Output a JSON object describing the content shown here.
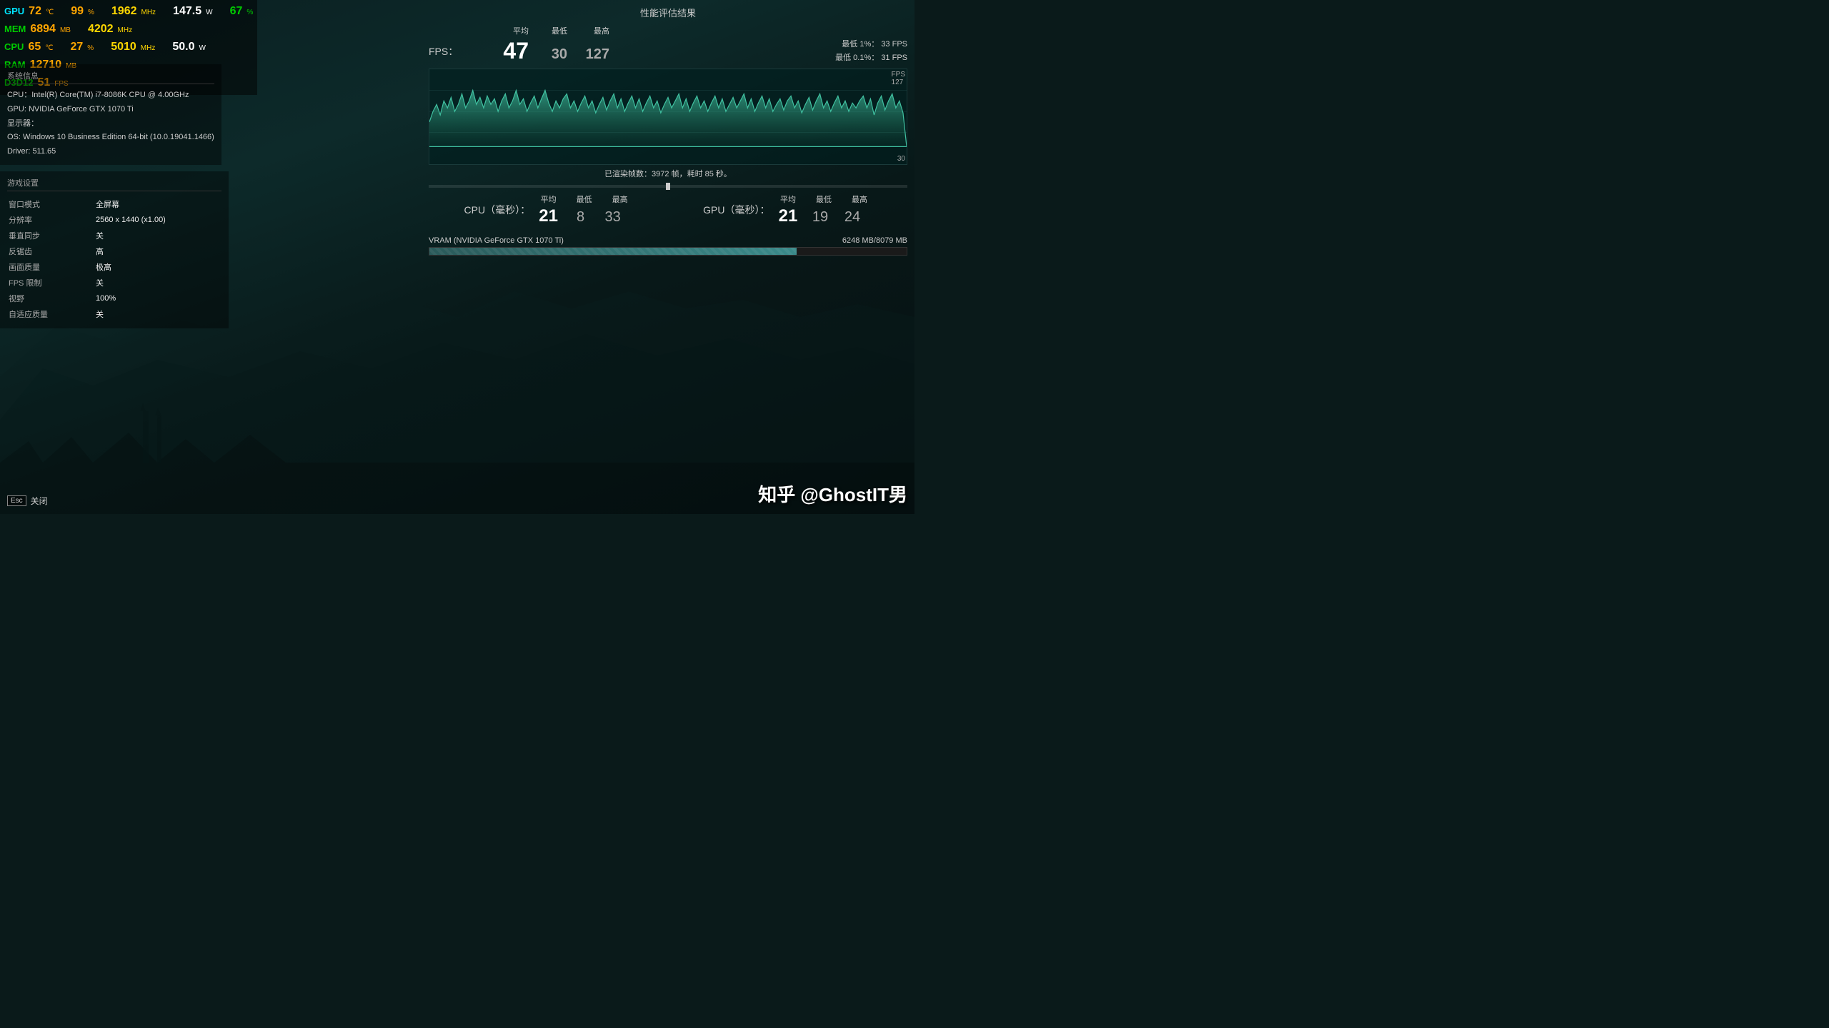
{
  "hw_monitor": {
    "gpu_label": "GPU",
    "gpu_temp": "72",
    "gpu_temp_unit": "℃",
    "gpu_usage": "99",
    "gpu_usage_unit": "%",
    "gpu_clock": "1962",
    "gpu_clock_unit": "MHz",
    "gpu_power": "147.5",
    "gpu_power_unit": "W",
    "gpu_vram": "67",
    "gpu_vram_unit": "%",
    "mem_label": "MEM",
    "mem_val": "6894",
    "mem_unit": "MB",
    "mem_clock": "4202",
    "mem_clock_unit": "MHz",
    "cpu_label": "CPU",
    "cpu_temp": "65",
    "cpu_temp_unit": "℃",
    "cpu_usage": "27",
    "cpu_usage_unit": "%",
    "cpu_clock": "5010",
    "cpu_clock_unit": "MHz",
    "cpu_power": "50.0",
    "cpu_power_unit": "W",
    "ram_label": "RAM",
    "ram_val": "12710",
    "ram_unit": "MB",
    "d3d_label": "D3D12",
    "d3d_fps": "51",
    "d3d_fps_unit": "FPS"
  },
  "system_info": {
    "title": "系统信息",
    "cpu": "CPU：Intel(R) Core(TM) i7-8086K CPU @ 4.00GHz",
    "gpu": "GPU: NVIDIA GeForce GTX 1070 Ti",
    "display": "显示器：",
    "os": "OS: Windows 10 Business Edition 64-bit (10.0.19041.1466)",
    "driver": "Driver: 511.65"
  },
  "game_settings": {
    "title": "游戏设置",
    "rows": [
      {
        "key": "窗口模式",
        "value": "全屏幕"
      },
      {
        "key": "分辨率",
        "value": "2560 x 1440 (x1.00)"
      },
      {
        "key": "垂直同步",
        "value": "关"
      },
      {
        "key": "反锯齿",
        "value": "高"
      },
      {
        "key": "画面质量",
        "value": "极高"
      },
      {
        "key": "FPS 限制",
        "value": "关"
      },
      {
        "key": "视野",
        "value": "100%"
      },
      {
        "key": "自适应质量",
        "value": "关"
      }
    ]
  },
  "perf_panel": {
    "title": "性能评估结果",
    "fps_label": "FPS：",
    "avg_label": "平均",
    "min_label": "最低",
    "max_label": "最高",
    "fps_avg": "47",
    "fps_min": "30",
    "fps_max": "127",
    "fps_low1_label": "最低 1%：",
    "fps_low1_val": "33 FPS",
    "fps_low01_label": "最低 0.1%：",
    "fps_low01_val": "31 FPS",
    "chart_fps_top": "FPS",
    "chart_fps_top_val": "127",
    "chart_fps_bottom_val": "30",
    "rendered_frames": "已渲染帧数：3972 帧，耗时 85 秒。",
    "cpu_label": "CPU（毫秒）：",
    "cpu_avg_h": "平均",
    "cpu_min_h": "最低",
    "cpu_max_h": "最高",
    "cpu_avg": "21",
    "cpu_min": "8",
    "cpu_max": "33",
    "gpu_label": "GPU（毫秒）：",
    "gpu_avg_h": "平均",
    "gpu_min_h": "最低",
    "gpu_max_h": "最高",
    "gpu_avg": "21",
    "gpu_min": "19",
    "gpu_max": "24",
    "vram_label": "VRAM (NVIDIA GeForce GTX 1070 Ti)",
    "vram_value": "6248 MB/8079 MB",
    "vram_percent": 77
  },
  "footer": {
    "esc_label": "Esc",
    "close_label": "关闭",
    "watermark": "知乎 @GhostIT男"
  }
}
